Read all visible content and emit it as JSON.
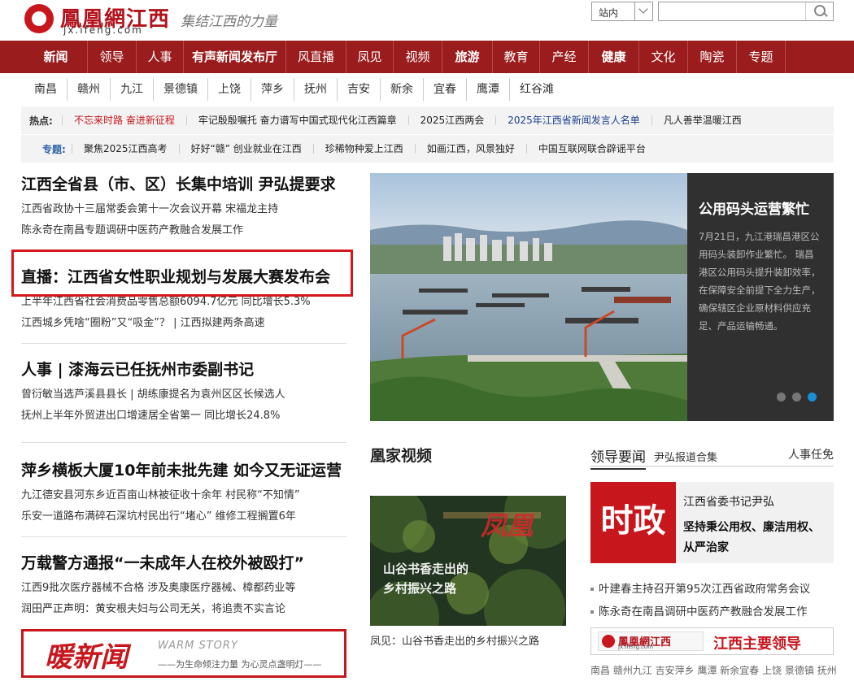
{
  "header": {
    "logo_cn": "鳳凰網江西",
    "logo_url": "jx.ifeng.com",
    "slogan": "集结江西的力量",
    "search_scope": "站内",
    "search_placeholder": ""
  },
  "nav": [
    {
      "label": "新闻",
      "bold": true,
      "w": 78
    },
    {
      "label": "领导",
      "bold": false,
      "w": 60
    },
    {
      "label": "人事",
      "bold": false,
      "w": 58
    },
    {
      "label": "有声新闻发布厅",
      "bold": true,
      "w": 126
    },
    {
      "label": "风直播",
      "bold": false,
      "w": 74
    },
    {
      "label": "凤见",
      "bold": false,
      "w": 58
    },
    {
      "label": "视频",
      "bold": false,
      "w": 60
    },
    {
      "label": "旅游",
      "bold": true,
      "w": 62
    },
    {
      "label": "教育",
      "bold": false,
      "w": 58
    },
    {
      "label": "产经",
      "bold": false,
      "w": 60
    },
    {
      "label": "健康",
      "bold": true,
      "w": 62
    },
    {
      "label": "文化",
      "bold": false,
      "w": 60
    },
    {
      "label": "陶瓷",
      "bold": false,
      "w": 60
    },
    {
      "label": "专题",
      "bold": false,
      "w": 60
    }
  ],
  "cities": [
    "南昌",
    "赣州",
    "九江",
    "景德镇",
    "上饶",
    "萍乡",
    "抚州",
    "吉安",
    "新余",
    "宜春",
    "鹰潭",
    "红谷滩"
  ],
  "hot": {
    "label": "热点:",
    "items": [
      {
        "text": "不忘来时路 奋进新征程",
        "color": "red"
      },
      {
        "text": "牢记殷殷嘱托 奋力谱写中国式现代化江西篇章",
        "color": ""
      },
      {
        "text": "2025江西两会",
        "color": ""
      },
      {
        "text": "2025年江西省新闻发言人名单",
        "color": "blue"
      },
      {
        "text": "凡人善举温暖江西",
        "color": ""
      }
    ]
  },
  "topics": {
    "label": "专题:",
    "items": [
      "聚焦2025江西高考",
      "好好“赣” 创业就业在江西",
      "珍稀物种爱上江西",
      "如画江西，风景独好",
      "中国互联网联合辟谣平台"
    ]
  },
  "news": [
    {
      "headline": "江西全省县（市、区）长集中培训 尹弘提要求",
      "subs": [
        "江西省政协十三届常委会第十一次会议开幕 宋福龙主持",
        "陈永奇在南昌专题调研中医药产教融合发展工作"
      ]
    },
    {
      "headline": "直播：江西省女性职业规划与发展大赛发布会",
      "subs": [
        "上半年江西省社会消费品零售总额6094.7亿元 同比增长5.3%",
        "江西城乡凭啥“圈粉”又“吸金”？ | 江西拟建两条高速"
      ]
    },
    {
      "headline": "人事 | 漆海云已任抚州市委副书记",
      "subs": [
        "曾衍敏当选芦溪县县长 | 胡练康提名为袁州区区长候选人",
        "抚州上半年外贸进出口增速居全省第一 同比增长24.8%"
      ]
    },
    {
      "headline": "萍乡横板大厦10年前未批先建 如今又无证运营",
      "subs": [
        "九江德安县河东乡近百亩山林被征收十余年 村民称“不知情”",
        "乐安一道路布满碎石深坑村民出行“堵心” 维修工程搁置6年"
      ]
    },
    {
      "headline": "万载警方通报“一未成年人在校外被殴打”",
      "subs": [
        "江西9批次医疗器械不合格 涉及奥康医疗器械、樟都药业等",
        "润田严正声明：黄安根夫妇与公司无关，将追责不实言论"
      ]
    }
  ],
  "warm": {
    "big": "暖新闻",
    "en": "WARM STORY",
    "sub": "——为生命倾注力量 为心灵点盏明灯——"
  },
  "slider": {
    "title": "公用码头运营繁忙",
    "desc": "7月21日，九江港瑞昌港区公用码头装卸作业繁忙。 瑞昌港区公用码头提升装卸效率，在保障安全前提下全力生产，确保辖区企业原材料供应充足、产品运输畅通。"
  },
  "video": {
    "title": "凰家视频",
    "overlay1": "山谷书香走出的",
    "overlay2": "乡村振兴之路",
    "watermark": "凤凰",
    "caption": "凤见：山谷书香走出的乡村振兴之路"
  },
  "leaders": {
    "tab_a": "领导要闻",
    "tab_b": "尹弘报道合集",
    "tab_c": "人事任免",
    "badge": "时政",
    "name": "江西省委书记尹弘",
    "quote": "坚持秉公用权、廉洁用权、从严治家",
    "items": [
      "叶建春主持召开第95次江西省政府常务会议",
      "陈永奇在南昌调研中医药产教融合发展工作"
    ],
    "banner_logo": "鳳凰網江西",
    "banner_url": "jx.ifeng.com",
    "banner_text": "江西主要领导",
    "cityline": "南昌 赣州九江 吉安萍乡 鹰潭 新余宜春 上饶 景德镇 抚州"
  },
  "colors": {
    "brand": "#9a1c1d",
    "accent_red": "#c8161d",
    "highlight": "#d6161c",
    "dot_active": "#1a8fd6"
  }
}
